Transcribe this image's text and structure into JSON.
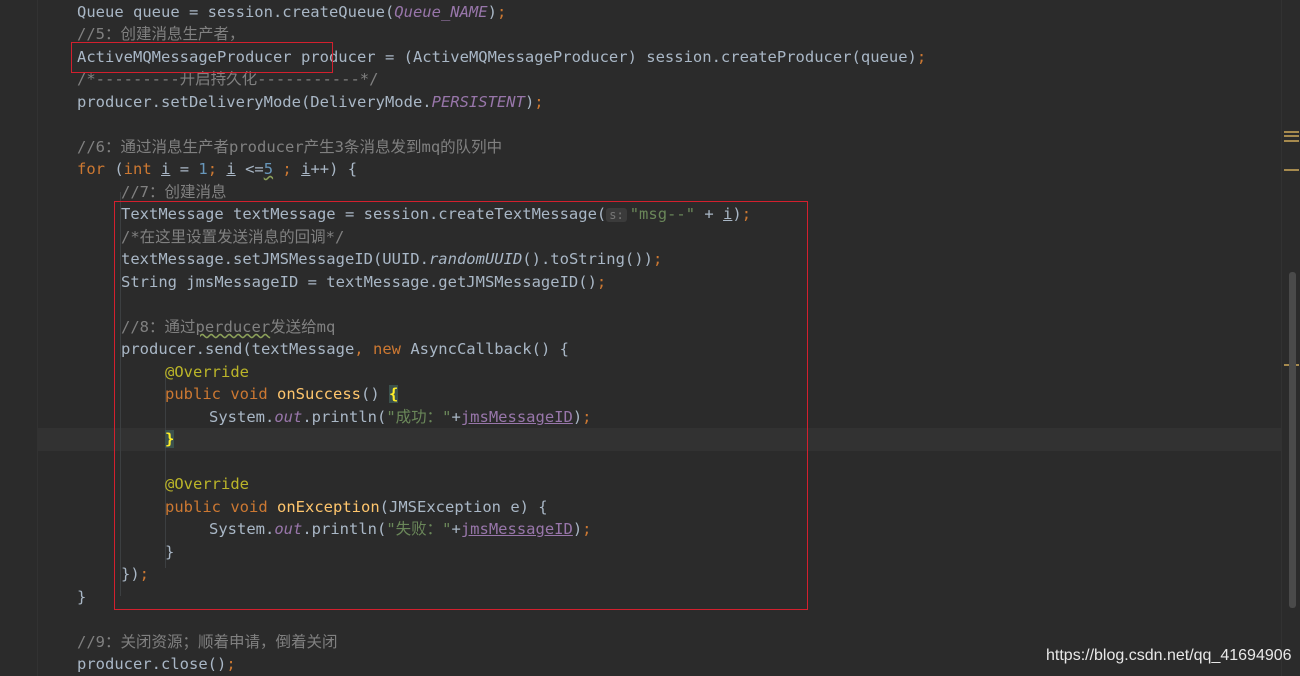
{
  "code": {
    "l1": {
      "a": "Queue queue = session.createQueue(",
      "b": "Queue_NAME",
      "c": ")",
      "d": ";"
    },
    "l2": "//5：创建消息生产者，",
    "l3": {
      "a": "ActiveMQMessageProducer",
      "b": " producer = (ActiveMQMessageProducer) session.createProducer(queue)",
      "c": ";"
    },
    "l4": "/*---------开启持久化-----------*/",
    "l5": {
      "a": "producer.setDeliveryMode(DeliveryMode.",
      "b": "PERSISTENT",
      "c": ")",
      "d": ";"
    },
    "l6": "//6：通过消息生产者producer产生3条消息发到mq的队列中",
    "l7": {
      "for": "for",
      "p1": " (",
      "int": "int",
      "sp": " ",
      "i1": "i",
      "eq": " = ",
      "n1": "1",
      "semi1": ";",
      "sp2": " ",
      "i2": "i",
      "lte": " <=",
      "n5": "5",
      "sp3": " ",
      "semi2": ";",
      "sp4": " ",
      "i3": "i",
      "rest": "++) {"
    },
    "l8": "//7：创建消息",
    "l9": {
      "a": "TextMessage textMessage = session.createTextMessage(",
      "hint": "s:",
      "str": "\"msg--\"",
      "plus": " + ",
      "i": "i",
      "c": ")",
      "d": ";"
    },
    "l10": "/*在这里设置发送消息的回调*/",
    "l11": {
      "a": "textMessage.setJMSMessageID(UUID.",
      "b": "randomUUID",
      "c": "().toString())",
      "d": ";"
    },
    "l12": {
      "a": "String jmsMessageID = textMessage.getJMSMessageID()",
      "d": ";"
    },
    "l13": {
      "a": "//8：通过",
      "b": "perducer",
      "c": "发送给mq"
    },
    "l14": {
      "a": "producer.send(textMessage",
      "comma": ",",
      "sp": " ",
      "new": "new",
      "b": " AsyncCallback() {"
    },
    "l15": "@Override",
    "l16": {
      "pub": "public",
      "sp": " ",
      "void": "void",
      "sp2": " ",
      "fn": "onSuccess",
      "b": "() ",
      "brace": "{"
    },
    "l17": {
      "a": "System.",
      "out": "out",
      "b": ".println(",
      "str": "\"成功：\"",
      "plus": "+",
      "field": "jmsMessageID",
      "c": ")",
      "d": ";"
    },
    "l18": "}",
    "l19": "@Override",
    "l20": {
      "pub": "public",
      "sp": " ",
      "void": "void",
      "sp2": " ",
      "fn": "onException",
      "b": "(JMSException e) {"
    },
    "l21": {
      "a": "System.",
      "out": "out",
      "b": ".println(",
      "str": "\"失败：\"",
      "plus": "+",
      "field": "jmsMessageID",
      "c": ")",
      "d": ";"
    },
    "l22": "}",
    "l23": {
      "a": "})",
      "d": ";"
    },
    "l24": "}",
    "l25": "//9：关闭资源；顺着申请，倒着关闭",
    "l26": {
      "a": "producer.close()",
      "d": ";"
    }
  },
  "watermark": "https://blog.csdn.net/qq_41694906",
  "colors": {
    "background": "#2b2b2b",
    "keyword": "#cc7832",
    "string": "#6a8759",
    "number": "#6897bb",
    "comment": "#808080",
    "annotation": "#bbb529",
    "method": "#ffc66d",
    "field": "#9876aa",
    "highlight_box": "#d3202e"
  }
}
